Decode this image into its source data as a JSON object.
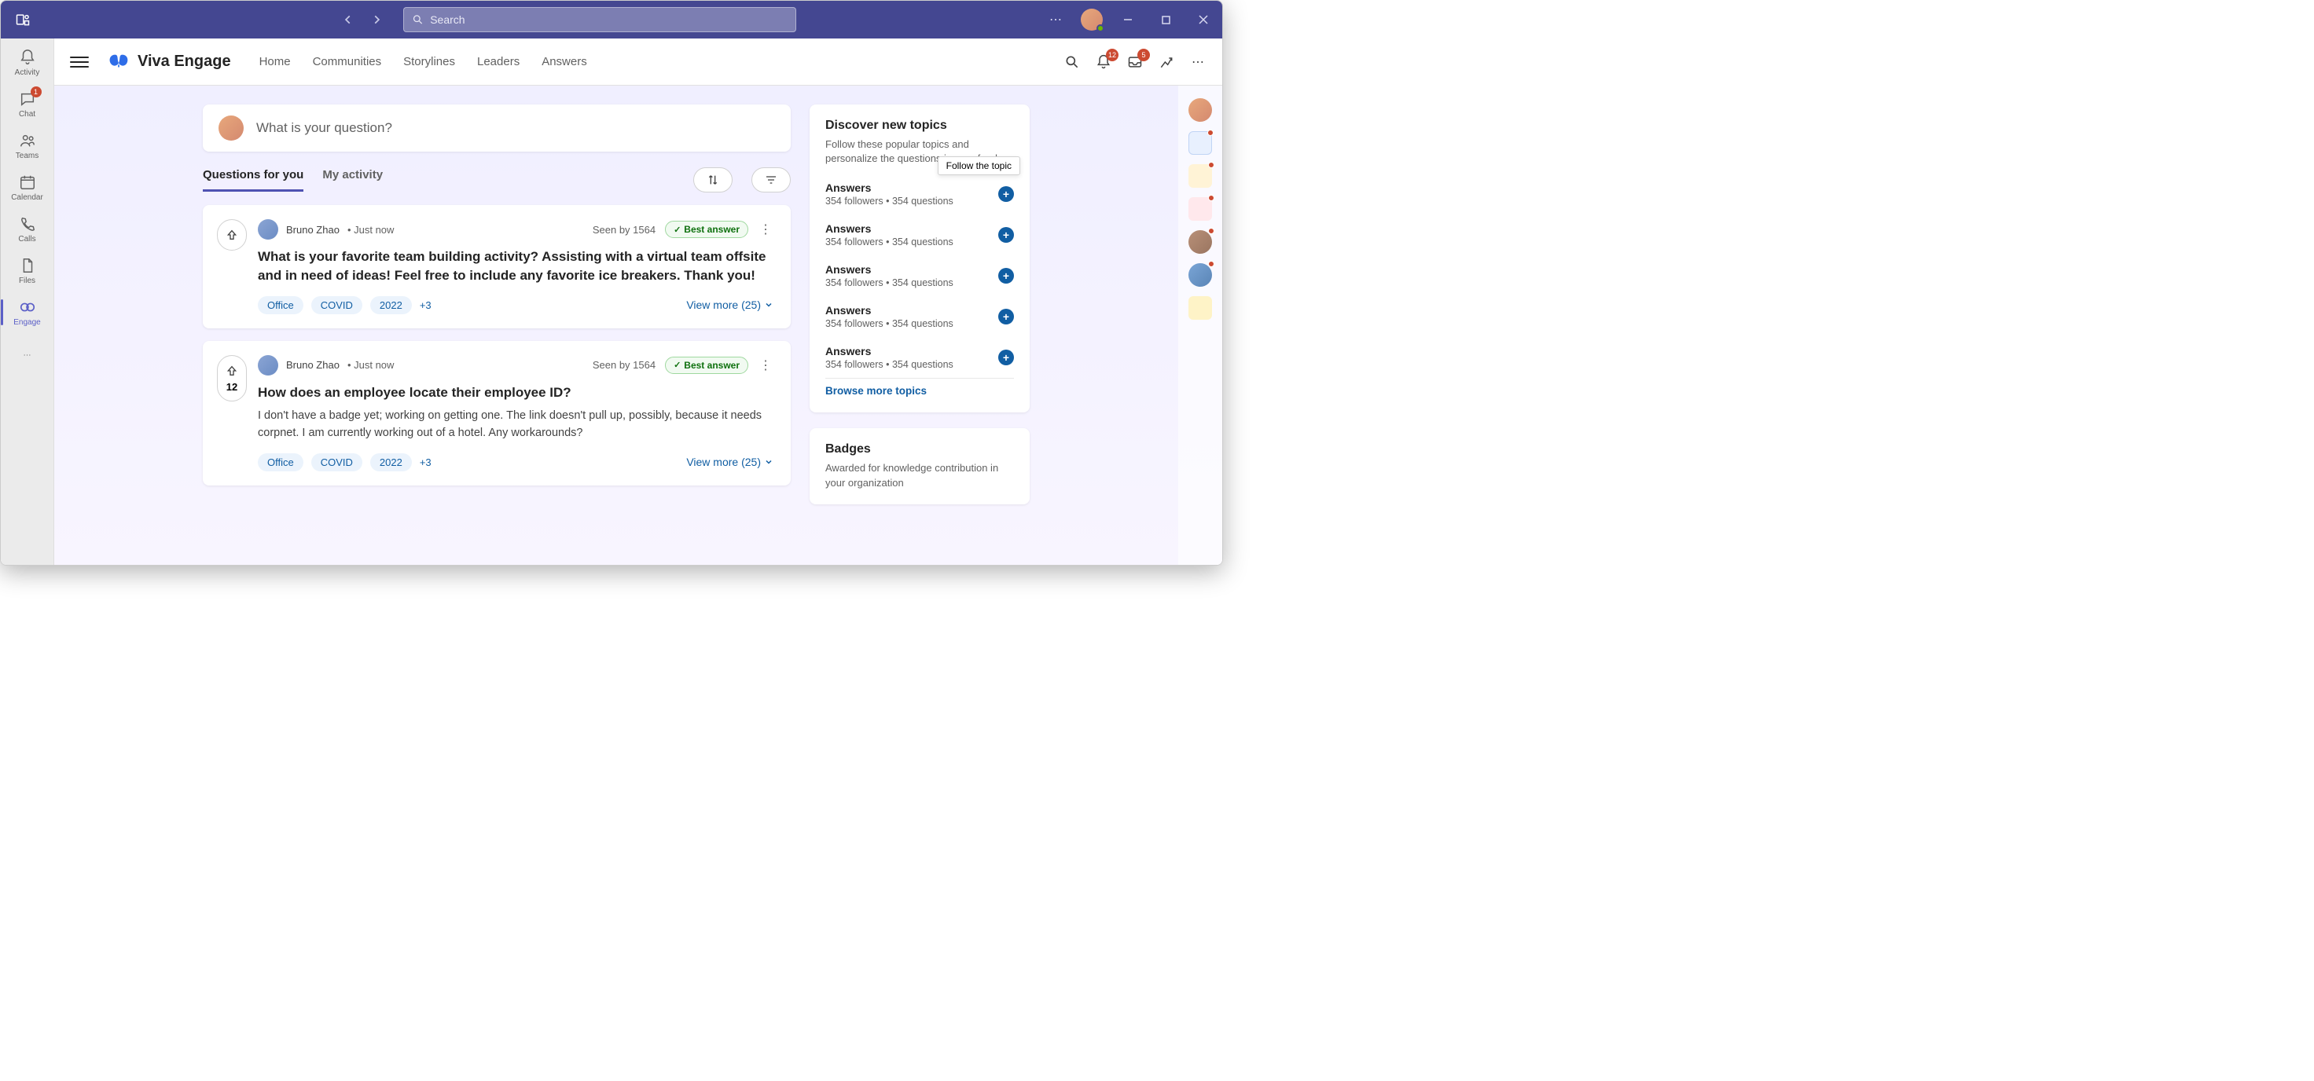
{
  "titlebar": {
    "search_placeholder": "Search"
  },
  "rail": {
    "activity": "Activity",
    "chat": "Chat",
    "chat_badge": "1",
    "teams": "Teams",
    "calendar": "Calendar",
    "calls": "Calls",
    "files": "Files",
    "engage": "Engage"
  },
  "header": {
    "brand": "Viva Engage",
    "nav": {
      "home": "Home",
      "communities": "Communities",
      "storylines": "Storylines",
      "leaders": "Leaders",
      "answers": "Answers"
    },
    "notif_badge": "12",
    "inbox_badge": "5"
  },
  "composer": {
    "placeholder": "What is your question?"
  },
  "tabs": {
    "for_you": "Questions for you",
    "my_activity": "My activity"
  },
  "cards": [
    {
      "author": "Bruno Zhao",
      "time": "Just now",
      "seen": "Seen by 1564",
      "best": "Best answer",
      "title": "What is your favorite team building activity? Assisting with a virtual team offsite and in need of ideas! Feel free to include any favorite ice breakers. Thank you!",
      "desc": "",
      "tags": [
        "Office",
        "COVID",
        "2022"
      ],
      "tag_more": "+3",
      "viewmore": "View more (25)",
      "votes": ""
    },
    {
      "author": "Bruno Zhao",
      "time": "Just now",
      "seen": "Seen by 1564",
      "best": "Best answer",
      "title": "How does an employee locate their employee ID?",
      "desc": "I don't have a badge yet; working on getting one. The link doesn't pull up, possibly, because it needs corpnet. I am currently working out of a hotel. Any workarounds?",
      "tags": [
        "Office",
        "COVID",
        "2022"
      ],
      "tag_more": "+3",
      "viewmore": "View more (25)",
      "votes": "12"
    }
  ],
  "discover": {
    "title": "Discover new topics",
    "subtitle": "Follow these popular topics and personalize the questions in your feed",
    "tooltip": "Follow the topic",
    "topics": [
      {
        "name": "Answers",
        "meta": "354 followers • 354 questions"
      },
      {
        "name": "Answers",
        "meta": "354 followers • 354 questions"
      },
      {
        "name": "Answers",
        "meta": "354 followers • 354 questions"
      },
      {
        "name": "Answers",
        "meta": "354 followers • 354 questions"
      },
      {
        "name": "Answers",
        "meta": "354 followers • 354 questions"
      }
    ],
    "browse": "Browse more topics"
  },
  "badges": {
    "title": "Badges",
    "subtitle": "Awarded for knowledge contribution in your organization"
  }
}
